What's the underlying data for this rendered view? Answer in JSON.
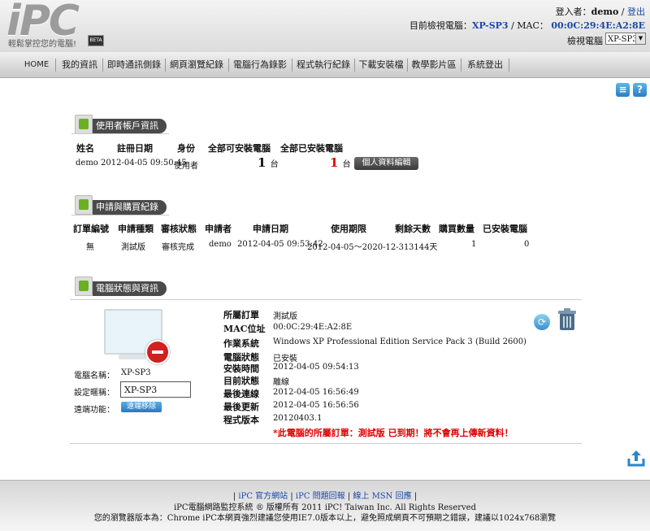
{
  "header": {
    "logo": "iPC",
    "tagline": "輕鬆掌控您的電腦!",
    "beta": "BETA",
    "login_label": "登入者：",
    "login_user": "demo",
    "logout": "登出",
    "viewing_label": "目前檢視電腦：",
    "viewing_machine": "XP-SP3",
    "mac_label": "/ MAC：",
    "mac_value": "00:0C:29:4E:A2:8E",
    "select_label": "檢視電腦",
    "select_value": "XP-SP3"
  },
  "nav": [
    "HOME",
    "我的資訊",
    "即時通訊側錄",
    "網頁瀏覽紀錄",
    "電腦行為錄影",
    "程式執行紀錄",
    "下載安裝檔",
    "教學影片區",
    "系統登出"
  ],
  "account": {
    "title": "使用者帳戶資訊",
    "headers": [
      "姓名",
      "註冊日期",
      "身份",
      "全部可安裝電腦",
      "全部已安裝電腦"
    ],
    "name": "demo",
    "reg_date": "2012-04-05 09:50:45",
    "role": "使用者",
    "installable": "1",
    "installed": "1",
    "unit": "台",
    "edit_button": "個人資料編輯"
  },
  "purchase": {
    "title": "申請與購買紀錄",
    "headers": [
      "訂單編號",
      "申請種類",
      "審核狀態",
      "申請者",
      "申請日期",
      "使用期限",
      "剩餘天數",
      "購買數量",
      "已安裝電腦"
    ],
    "row": [
      "無",
      "測試版",
      "審核完成",
      "demo",
      "2012-04-05 09:53:42",
      "2012-04-05～2020-12-31",
      "3144天",
      "1",
      "0"
    ]
  },
  "computer": {
    "title": "電腦狀態與資訊",
    "name_label": "電腦名稱：",
    "name_value": "XP-SP3",
    "nick_label": "設定暱稱：",
    "nick_value": "XP-SP3",
    "remote_label": "遠端功能：",
    "remote_button": "遠端移除",
    "fields": [
      {
        "label": "所屬訂單",
        "value": "測試版"
      },
      {
        "label": "MAC位址",
        "value": "00:0C:29:4E:A2:8E"
      },
      {
        "label": "作業系統",
        "value": "Windows XP  Professional Edition  Service Pack 3  (Build 2600)"
      },
      {
        "label": "電腦狀態",
        "value": "已安裝"
      },
      {
        "label": "安裝時間",
        "value": "2012-04-05 09:54:13"
      },
      {
        "label": "目前狀態",
        "value": "離線"
      },
      {
        "label": "最後連線",
        "value": "2012-04-05 16:56:49"
      },
      {
        "label": "最後更新",
        "value": "2012-04-05 16:56:56"
      },
      {
        "label": "程式版本",
        "value": "20120403.1"
      }
    ],
    "warning": "*此電腦的所屬訂單：測試版 已到期！將不會再上傳新資料！"
  },
  "footer": {
    "link1": "iPC 官方網站",
    "link2": "iPC 問題回報",
    "link3": "線上 MSN 回應",
    "copyright": "iPC電腦網路監控系統 ® 版權所有 2011 iPC! Taiwan Inc. All Rights Reserved",
    "browser_note": "您的瀏覽器版本為：Chrome  iPC本網頁強烈建議您使用IE7.0版本以上，避免照成網頁不可預期之錯誤，建議以1024x768瀏覽"
  }
}
